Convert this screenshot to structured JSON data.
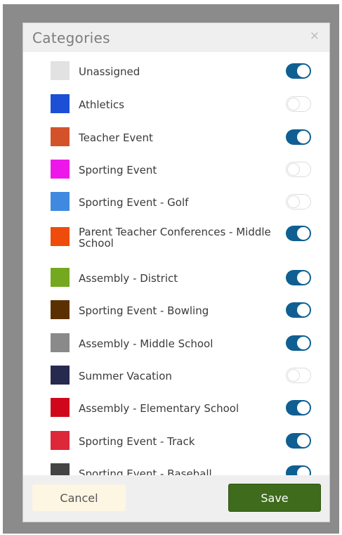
{
  "dialog": {
    "title": "Categories",
    "close_glyph": "×",
    "close_icon": "close-icon"
  },
  "categories": [
    {
      "label": "Unassigned",
      "color": "#e2e2e2",
      "enabled": true
    },
    {
      "label": "Athletics",
      "color": "#1c4fd6",
      "enabled": false
    },
    {
      "label": "Teacher Event",
      "color": "#d4522a",
      "enabled": true
    },
    {
      "label": "Sporting Event",
      "color": "#ee17ea",
      "enabled": false
    },
    {
      "label": "Sporting Event - Golf",
      "color": "#3f8ae0",
      "enabled": false
    },
    {
      "label": "Parent Teacher Conferences - Middle School",
      "color": "#ef4c0c",
      "enabled": true
    },
    {
      "label": "Assembly - District",
      "color": "#74a81f",
      "enabled": true
    },
    {
      "label": "Sporting Event - Bowling",
      "color": "#5b3000",
      "enabled": true
    },
    {
      "label": "Assembly - Middle School",
      "color": "#8a8a8a",
      "enabled": true
    },
    {
      "label": "Summer Vacation",
      "color": "#262a4f",
      "enabled": false
    },
    {
      "label": "Assembly - Elementary School",
      "color": "#d0061c",
      "enabled": true
    },
    {
      "label": "Sporting Event - Track",
      "color": "#dc2838",
      "enabled": true
    },
    {
      "label": "Sporting Event - Baseball",
      "color": "#444444",
      "enabled": true
    }
  ],
  "footer": {
    "cancel_label": "Cancel",
    "save_label": "Save"
  },
  "colors": {
    "toggle_on": "#0f5f93",
    "save_button": "#3f6b1c",
    "cancel_button": "#fdf6e3",
    "overlay": "#8b8b8b"
  }
}
